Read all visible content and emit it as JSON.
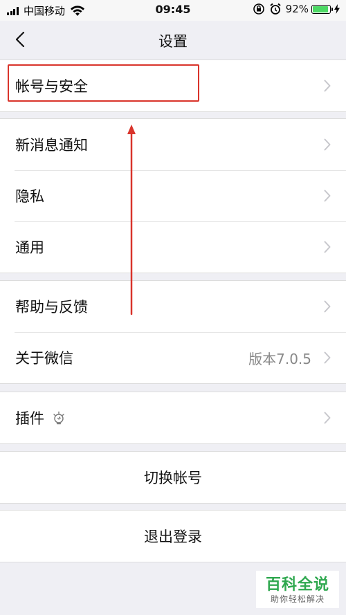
{
  "status_bar": {
    "carrier": "中国移动",
    "time": "09:45",
    "battery_percent": "92%",
    "battery_level": 0.92,
    "icons": [
      "signal-icon",
      "wifi-icon",
      "rotation-lock-icon",
      "alarm-icon",
      "battery-icon",
      "charging-bolt-icon"
    ]
  },
  "nav": {
    "title": "设置",
    "back_icon": "chevron-left-icon"
  },
  "groups": {
    "account": {
      "security": "帐号与安全"
    },
    "general": {
      "notifications": "新消息通知",
      "privacy": "隐私",
      "general": "通用"
    },
    "support": {
      "help_feedback": "帮助与反馈",
      "about": "关于微信",
      "version": "版本7.0.5"
    },
    "plugins": {
      "plugins": "插件",
      "icon": "lightbulb-icon"
    },
    "switch_account": "切换帐号",
    "logout": "退出登录"
  },
  "annotation": {
    "highlight_color": "#d9342b"
  },
  "watermark": {
    "main": "百科全说",
    "sub": "助你轻松解决"
  },
  "colors": {
    "background": "#efeff4",
    "cell": "#ffffff",
    "battery_fill": "#4cd964",
    "watermark_green": "#2fa84f"
  }
}
